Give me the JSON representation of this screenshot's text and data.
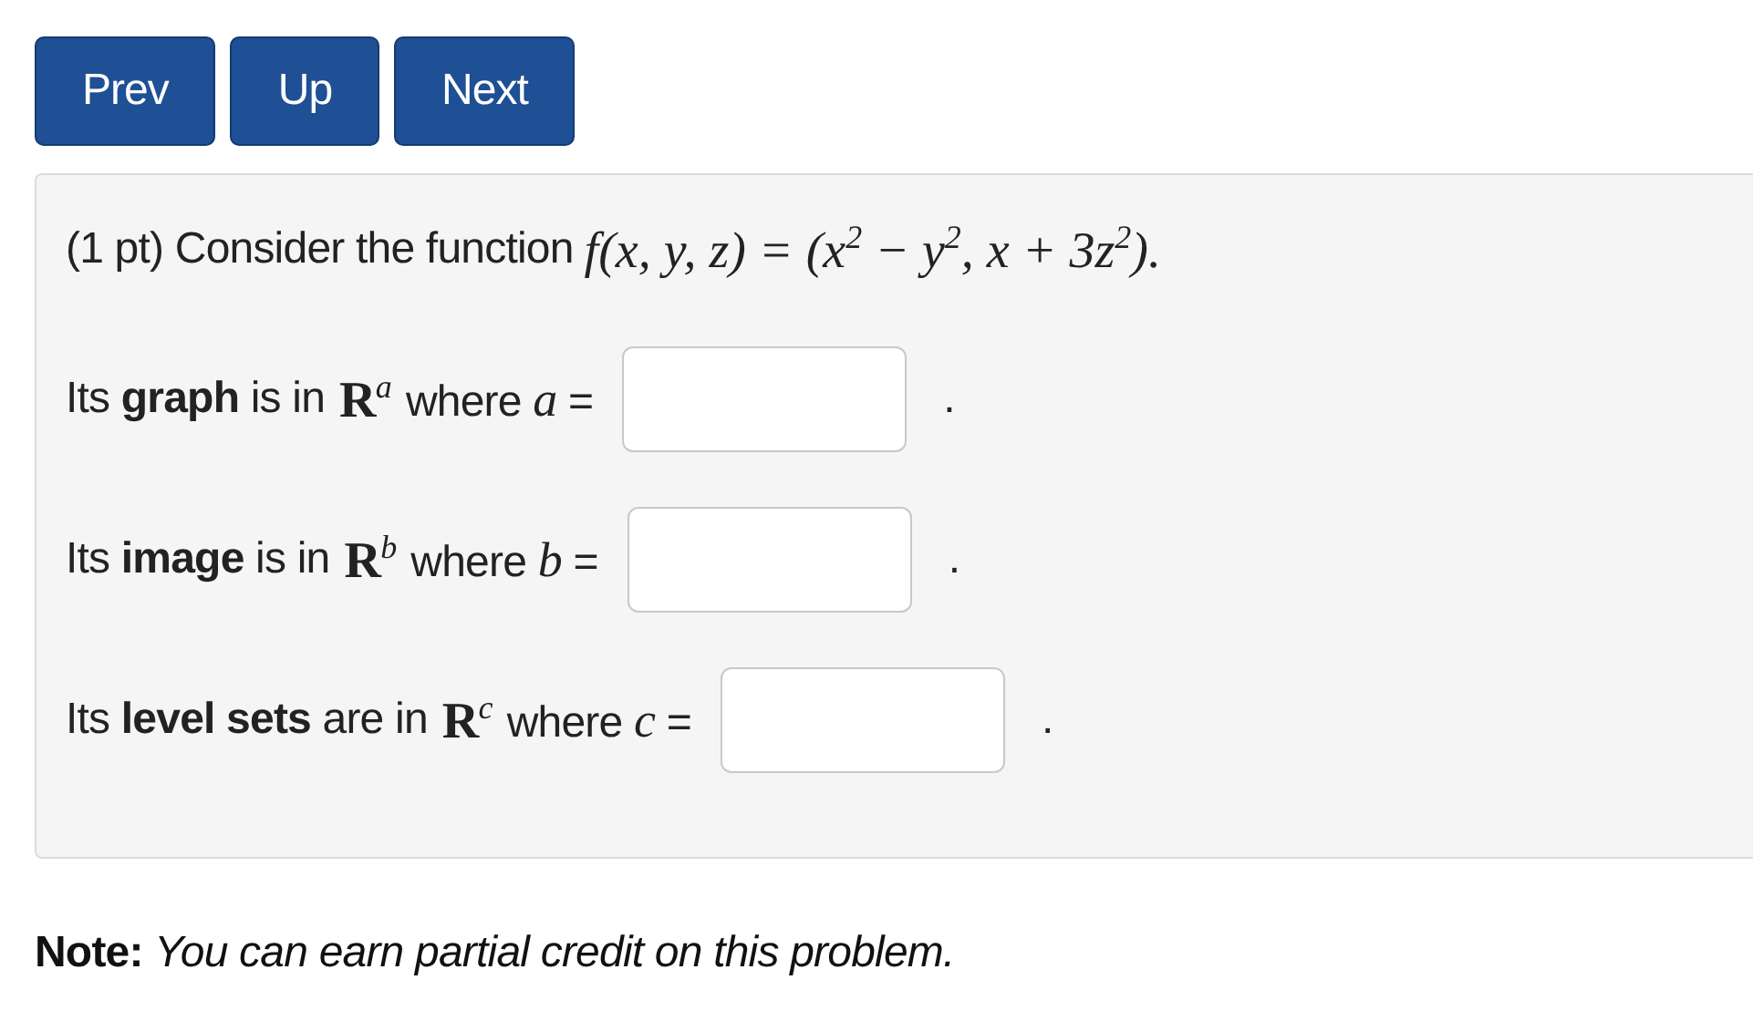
{
  "nav_buttons": [
    {
      "label": "Prev"
    },
    {
      "label": "Up"
    },
    {
      "label": "Next"
    }
  ],
  "problem": {
    "intro": "(1 pt) Consider the function",
    "formula": "f(x, y, z) = (x$^{2}$ − y$^{2}$, x + 3z$^{2}$).",
    "questions": [
      {
        "prefix": "Its **graph** is in",
        "space": "R$^{a}$",
        "suffix": "where *a* =",
        "period": "."
      },
      {
        "prefix": "Its **image** is in",
        "space": "R$^{b}$",
        "suffix": "where *b* =",
        "period": "."
      },
      {
        "prefix": "Its **level sets** are in",
        "space": "R$^{c}$",
        "suffix": "where *c* =",
        "period": "."
      }
    ]
  },
  "note": "**Note:** *You can earn partial credit on this problem.*"
}
